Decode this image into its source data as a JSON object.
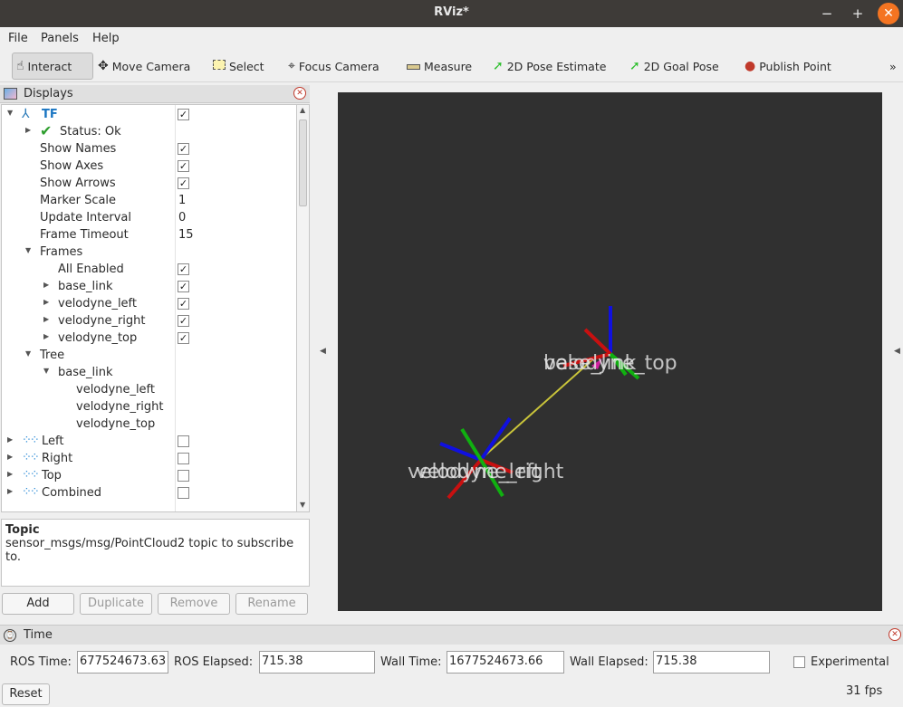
{
  "window": {
    "title": "RViz*",
    "minimize": "−",
    "maximize": "+",
    "close": "✕"
  },
  "menu": [
    "File",
    "Panels",
    "Help"
  ],
  "toolbar": {
    "tools": [
      {
        "label": "Interact",
        "icon": "hand-icon"
      },
      {
        "label": "Move Camera",
        "icon": "move-camera-icon"
      },
      {
        "label": "Select",
        "icon": "select-icon"
      },
      {
        "label": "Focus Camera",
        "icon": "focus-camera-icon"
      },
      {
        "label": "Measure",
        "icon": "ruler-icon"
      },
      {
        "label": "2D Pose Estimate",
        "icon": "pose-arrow-icon"
      },
      {
        "label": "2D Goal Pose",
        "icon": "goal-arrow-icon"
      },
      {
        "label": "Publish Point",
        "icon": "map-pin-icon"
      }
    ],
    "overflow": "»"
  },
  "displays": {
    "title": "Displays",
    "tf": {
      "name": "TF",
      "status": "Status: Ok",
      "props": [
        {
          "label": "Show Names",
          "checked": true
        },
        {
          "label": "Show Axes",
          "checked": true
        },
        {
          "label": "Show Arrows",
          "checked": true
        },
        {
          "label": "Marker Scale",
          "value": "1"
        },
        {
          "label": "Update Interval",
          "value": "0"
        },
        {
          "label": "Frame Timeout",
          "value": "15"
        }
      ],
      "frames_label": "Frames",
      "frames": [
        "All Enabled",
        "base_link",
        "velodyne_left",
        "velodyne_right",
        "velodyne_top"
      ],
      "tree_label": "Tree",
      "tree_root": "base_link",
      "tree_children": [
        "velodyne_left",
        "velodyne_right",
        "velodyne_top"
      ]
    },
    "clouds": [
      "Left",
      "Right",
      "Top",
      "Combined"
    ]
  },
  "description": {
    "title": "Topic",
    "text": "sensor_msgs/msg/PointCloud2 topic to subscribe to."
  },
  "buttons": {
    "add": "Add",
    "duplicate": "Duplicate",
    "remove": "Remove",
    "rename": "Rename"
  },
  "viewport": {
    "top_frame_label": "velodyne_top",
    "bottom_frame_label": "velodyne_right",
    "top_overlap_label": "base_link",
    "bottom_overlap_label": "velodyne_left"
  },
  "time": {
    "title": "Time",
    "ros_time_label": "ROS Time:",
    "ros_time": "677524673.63",
    "ros_elapsed_label": "ROS Elapsed:",
    "ros_elapsed": "715.38",
    "wall_time_label": "Wall Time:",
    "wall_time": "1677524673.66",
    "wall_elapsed_label": "Wall Elapsed:",
    "wall_elapsed": "715.38",
    "experimental_label": "Experimental",
    "reset": "Reset",
    "fps": "31 fps"
  }
}
